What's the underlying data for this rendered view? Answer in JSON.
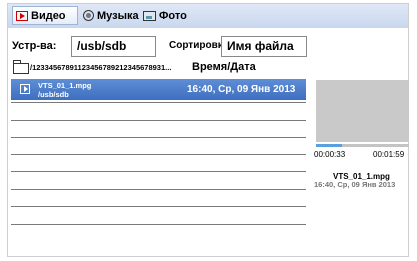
{
  "tabs": {
    "video": "Видео",
    "music": "Музыка",
    "photo": "Фото"
  },
  "device": {
    "label": "Устр-ва:",
    "value": "/usb/sdb"
  },
  "sort": {
    "label": "Сортировка:",
    "value": "Имя файла"
  },
  "path": {
    "current": "/12334567891123456789212345678931...",
    "sort_column": "Время/Дата"
  },
  "files": [
    {
      "name": "VTS_01_1.mpg",
      "path": "/usb/sdb",
      "datetime": "16:40, Ср, 09 Янв 2013",
      "selected": true
    }
  ],
  "preview": {
    "time_current": "00:00:33",
    "time_total": "00:01:59",
    "progress": 0.28,
    "file_name": "VTS_01_1.mpg",
    "file_datetime": "16:40, Ср, 09 Янв 2013"
  },
  "colors": {
    "tabbar": "#c9d7ee",
    "selected_row": "#4a7cc9",
    "progress": "#5aa0dd",
    "preview_bg": "#c9c9c9"
  }
}
